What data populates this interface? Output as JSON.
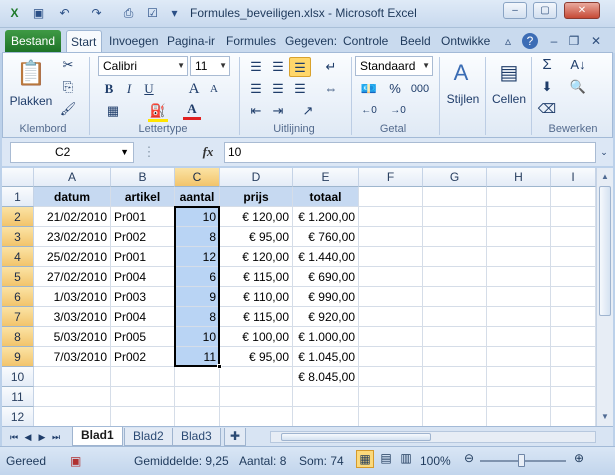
{
  "window": {
    "title": "Formules_beveiligen.xlsx - Microsoft Excel"
  },
  "tabs": [
    "Bestand",
    "Start",
    "Invoegen",
    "Pagina-ir",
    "Formules",
    "Gegeven:",
    "Controle",
    "Beeld",
    "Ontwikke"
  ],
  "ribbon": {
    "groups": [
      "Klembord",
      "Lettertype",
      "Uitlijning",
      "Getal",
      "Bewerken"
    ],
    "paste_label": "Plakken",
    "font_name": "Calibri",
    "font_size": "11",
    "number_format": "Standaard",
    "percent": "%",
    "thousands": "000",
    "styles_label": "Stijlen",
    "cells_label": "Cellen",
    "bold": "B",
    "italic": "I",
    "underline": "U",
    "grow_font": "A",
    "shrink_font": "A",
    "font_color": "A"
  },
  "formula_bar": {
    "cell_ref": "C2",
    "fx": "fx",
    "value": "10"
  },
  "grid": {
    "columns": [
      "A",
      "B",
      "C",
      "D",
      "E",
      "F",
      "G",
      "H",
      "I"
    ],
    "rows": [
      "1",
      "2",
      "3",
      "4",
      "5",
      "6",
      "7",
      "8",
      "9",
      "10",
      "11",
      "12"
    ],
    "headers": [
      "datum",
      "artikel",
      "aantal",
      "prijs",
      "totaal"
    ],
    "data": [
      [
        "21/02/2010",
        "Pr001",
        "10",
        "€ 120,00",
        "€ 1.200,00"
      ],
      [
        "23/02/2010",
        "Pr002",
        "8",
        "€ 95,00",
        "€ 760,00"
      ],
      [
        "25/02/2010",
        "Pr001",
        "12",
        "€ 120,00",
        "€ 1.440,00"
      ],
      [
        "27/02/2010",
        "Pr004",
        "6",
        "€ 115,00",
        "€ 690,00"
      ],
      [
        "1/03/2010",
        "Pr003",
        "9",
        "€ 110,00",
        "€ 990,00"
      ],
      [
        "3/03/2010",
        "Pr004",
        "8",
        "€ 115,00",
        "€ 920,00"
      ],
      [
        "5/03/2010",
        "Pr005",
        "10",
        "€ 100,00",
        "€ 1.000,00"
      ],
      [
        "7/03/2010",
        "Pr002",
        "11",
        "€ 95,00",
        "€ 1.045,00"
      ]
    ],
    "total": "€ 8.045,00"
  },
  "sheets": [
    "Blad1",
    "Blad2",
    "Blad3"
  ],
  "status": {
    "ready": "Gereed",
    "average": "Gemiddelde: 9,25",
    "count": "Aantal: 8",
    "sum": "Som: 74",
    "zoom": "100%"
  },
  "colors": {
    "file_tab": "#2d8a37",
    "selection": "#b9d4f4",
    "header_fill": "#c6d9f1",
    "close": "#c64a36"
  }
}
